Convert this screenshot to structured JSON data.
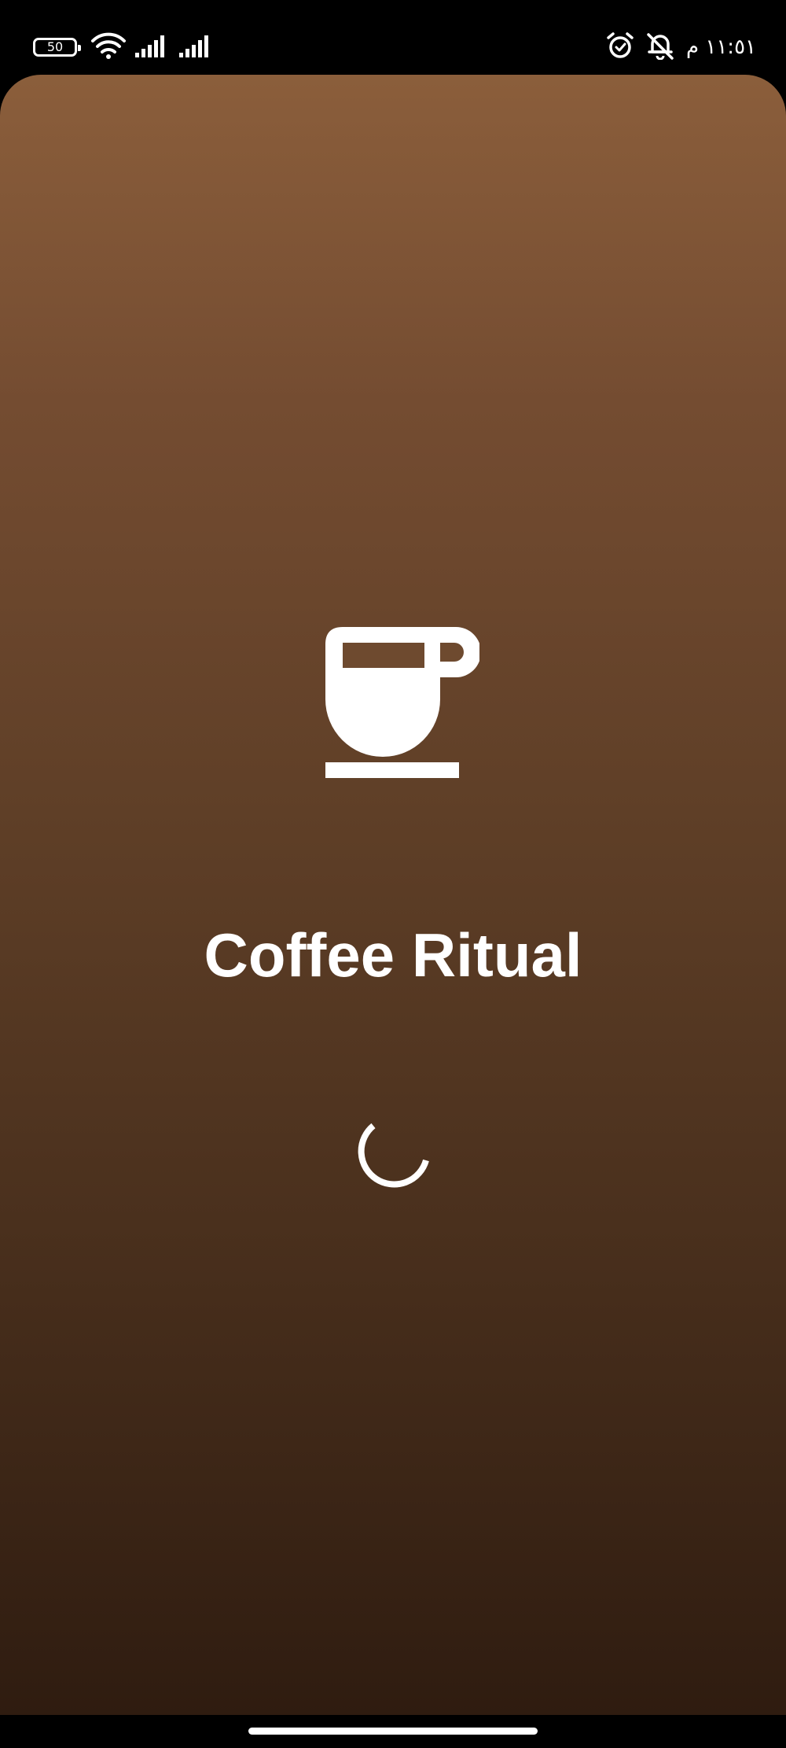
{
  "status_bar": {
    "battery_level": "50",
    "clock": "١١:٥١ م"
  },
  "app": {
    "title": "Coffee Ritual",
    "logo_icon": "coffee-cup-icon",
    "loading_icon": "loading-spinner-icon"
  },
  "colors": {
    "gradient_top": "#8b5e3b",
    "gradient_bottom": "#2f1c10",
    "foreground": "#ffffff"
  }
}
